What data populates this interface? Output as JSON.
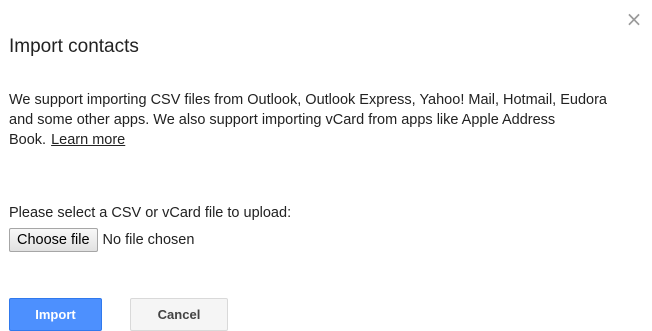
{
  "dialog": {
    "close_glyph": "×",
    "title": "Import contacts",
    "description": "We support importing CSV files from Outlook, Outlook Express, Yahoo! Mail, Hotmail, Eudora and some other apps. We also support importing vCard from apps like Apple Address Book.",
    "learn_more": "Learn more",
    "select_label": "Please select a CSV or vCard file to upload:",
    "choose_file_label": "Choose file",
    "no_file_text": "No file chosen",
    "import_label": "Import",
    "cancel_label": "Cancel"
  },
  "colors": {
    "primary": "#4d90fe",
    "primary_border": "#3079ed",
    "cancel_bg": "#f5f5f5",
    "text": "#222222"
  }
}
